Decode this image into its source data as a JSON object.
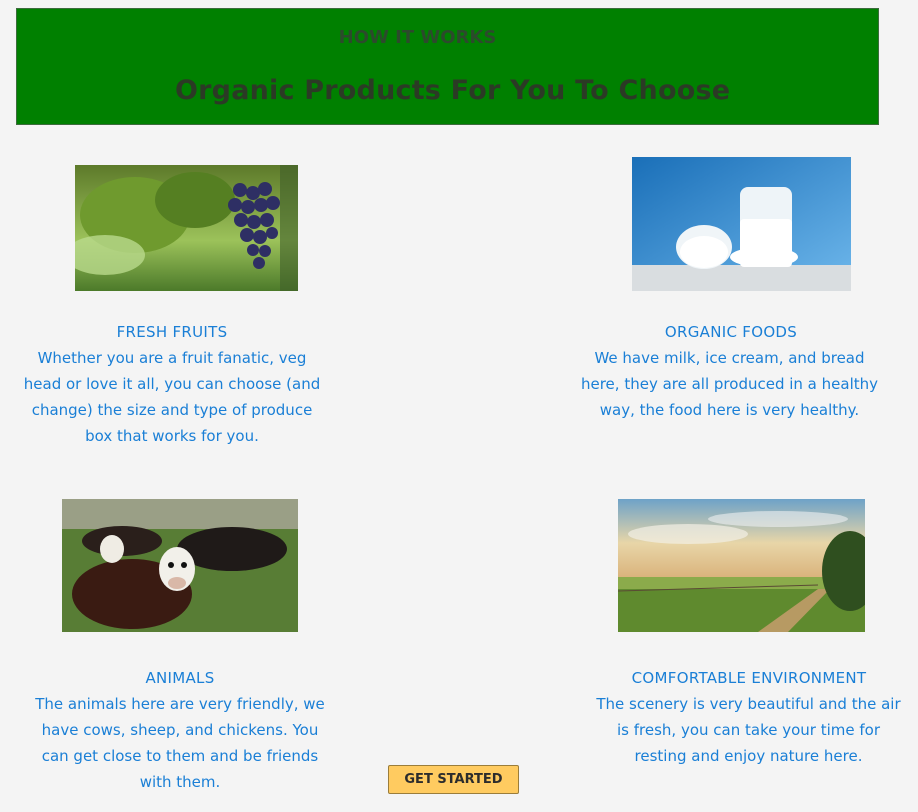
{
  "header": {
    "kicker": "HOW IT WORKS",
    "title": "Organic Products For You To Choose",
    "background": "#008000"
  },
  "cards": [
    {
      "title": "FRESH FRUITS",
      "text": "Whether you are a fruit fanatic, veg head or love it all, you can choose (and change) the size and type of produce box that works for you."
    },
    {
      "title": "ORGANIC FOODS",
      "text": "We have milk, ice cream, and bread here, they are all produced in a healthy way, the food here is very healthy."
    },
    {
      "title": "ANIMALS",
      "text": "The animals here are very friendly, we have cows, sheep, and chickens.  You can get close to them and be friends with them."
    },
    {
      "title": "COMFORTABLE ENVIRONMENT",
      "text": "The scenery is very beautiful and the air is fresh, you can take your time for resting and enjoy nature here."
    }
  ],
  "cta": {
    "label": "GET STARTED",
    "color": "#ffcb60"
  },
  "colors": {
    "text_accent": "#1a7fd6",
    "page_bg": "#f4f4f4"
  }
}
